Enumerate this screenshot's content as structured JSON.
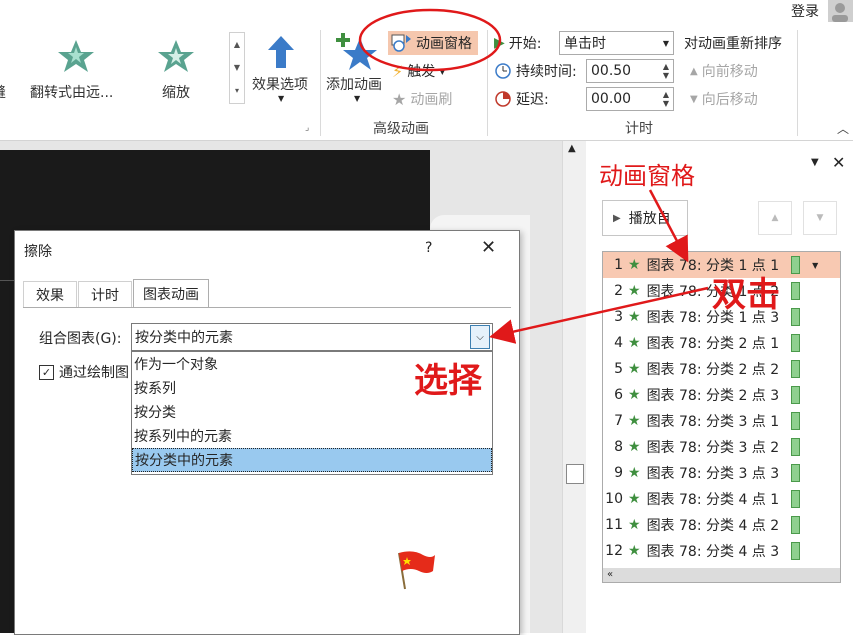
{
  "ribbon": {
    "login": "登录",
    "effects": [
      {
        "label": "翻转式由远...",
        "icon": "flip-star-icon"
      },
      {
        "label": "缩放",
        "icon": "zoom-star-icon"
      }
    ],
    "effect_options_label": "效果选项",
    "add_animation_label": "添加动画",
    "animation_pane_label": "动画窗格",
    "trigger_label": "触发",
    "animation_painter_label": "动画刷",
    "advanced_group_label": "高级动画",
    "start_label": "开始:",
    "start_value": "单击时",
    "duration_label": "持续时间:",
    "duration_value": "00.50",
    "delay_label": "延迟:",
    "delay_value": "00.00",
    "reorder_title": "对动画重新排序",
    "move_earlier_label": "向前移动",
    "move_later_label": "向后移动",
    "timing_group_label": "计时"
  },
  "dialog": {
    "title": "擦除",
    "help": "?",
    "tabs": [
      "效果",
      "计时",
      "图表动画"
    ],
    "group_chart_label": "组合图表(G):",
    "group_chart_value": "按分类中的元素",
    "checkbox_label": "通过绘制图",
    "options": [
      "作为一个对象",
      "按系列",
      "按分类",
      "按系列中的元素",
      "按分类中的元素"
    ],
    "selected_index": 4
  },
  "pane": {
    "title": "动画窗格",
    "play_label": "播放自",
    "items": [
      {
        "num": "1",
        "text": "图表 78: 分类 1 点 1"
      },
      {
        "num": "2",
        "text": "图表 78: 分类 1 点 2"
      },
      {
        "num": "3",
        "text": "图表 78: 分类 1 点 3"
      },
      {
        "num": "4",
        "text": "图表 78: 分类 2 点 1"
      },
      {
        "num": "5",
        "text": "图表 78: 分类 2 点 2"
      },
      {
        "num": "6",
        "text": "图表 78: 分类 2 点 3"
      },
      {
        "num": "7",
        "text": "图表 78: 分类 3 点 1"
      },
      {
        "num": "8",
        "text": "图表 78: 分类 3 点 2"
      },
      {
        "num": "9",
        "text": "图表 78: 分类 3 点 3"
      },
      {
        "num": "10",
        "text": "图表 78: 分类 4 点 1"
      },
      {
        "num": "11",
        "text": "图表 78: 分类 4 点 2"
      },
      {
        "num": "12",
        "text": "图表 78: 分类 4 点 3"
      }
    ],
    "selected_index": 0
  },
  "annotations": {
    "pane_callout": "动画窗格",
    "double_click": "双击",
    "select": "选择"
  },
  "colors": {
    "accent_red": "#e0191a",
    "selected_item": "#f8c9b2",
    "star_green": "#3f8f3f",
    "option_highlight": "#99c9ef"
  }
}
